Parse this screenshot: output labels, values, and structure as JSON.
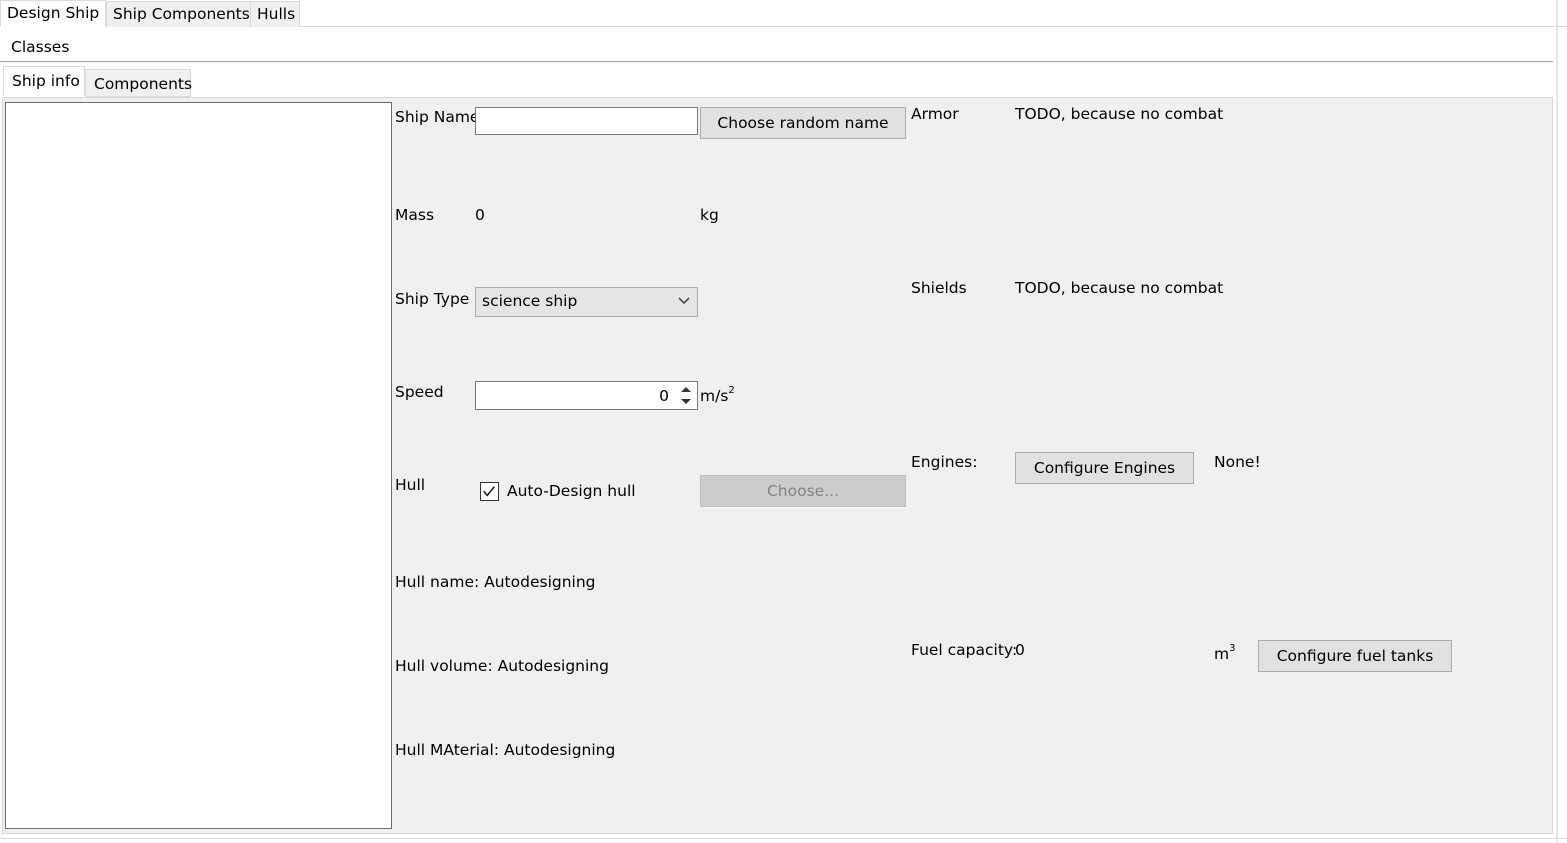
{
  "top_tabs": [
    {
      "label": "Design Ship",
      "active": true
    },
    {
      "label": "Ship Components",
      "active": false
    },
    {
      "label": "Hulls",
      "active": false
    }
  ],
  "classes_label": "Classes",
  "sub_tabs": [
    {
      "label": "Ship info",
      "active": true
    },
    {
      "label": "Components",
      "active": false
    }
  ],
  "form": {
    "ship_name": {
      "label": "Ship Name",
      "value": "",
      "random_button": "Choose random name"
    },
    "mass": {
      "label": "Mass",
      "value": "0",
      "unit": "kg"
    },
    "ship_type": {
      "label": "Ship Type",
      "selected": "science ship"
    },
    "speed": {
      "label": "Speed",
      "value": "0",
      "unit": "m/s",
      "unit_sup": "2"
    },
    "hull": {
      "label": "Hull",
      "auto_design_label": "Auto-Design hull",
      "auto_design_checked": true,
      "choose_button": "Choose..."
    },
    "hull_name": "Hull name: Autodesigning",
    "hull_volume": "Hull volume: Autodesigning",
    "hull_material": "Hull MAterial: Autodesigning",
    "armor": {
      "label": "Armor",
      "value": "TODO, because no combat"
    },
    "shields": {
      "label": "Shields",
      "value": "TODO, because no combat"
    },
    "engines": {
      "label": "Engines:",
      "button": "Configure Engines",
      "value": "None!"
    },
    "fuel": {
      "label": "Fuel capacity:",
      "value": "0",
      "unit": "m",
      "unit_sup": "3",
      "button": "Configure fuel tanks"
    }
  },
  "icons": {
    "dropdown": "chevron-down-icon",
    "check": "check-icon",
    "spin_up": "caret-up-icon",
    "spin_down": "caret-down-icon"
  }
}
